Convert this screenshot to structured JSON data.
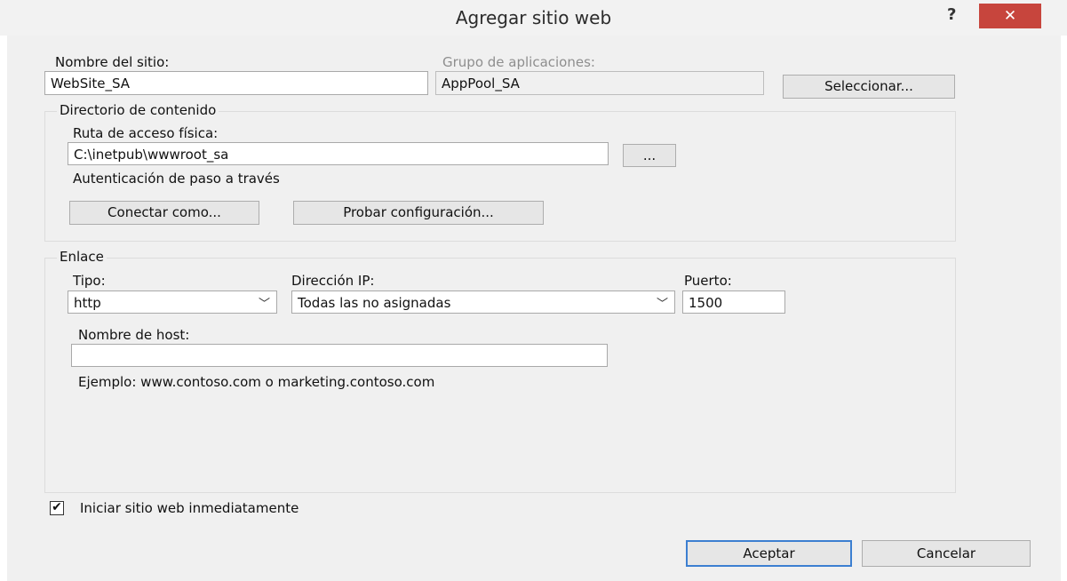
{
  "window": {
    "title": "Agregar sitio web",
    "help_glyph": "?",
    "close_glyph": "✕"
  },
  "site": {
    "name_label": "Nombre del sitio:",
    "name_value": "WebSite_SA",
    "app_pool_label": "Grupo de aplicaciones:",
    "app_pool_value": "AppPool_SA",
    "select_button": "Seleccionar..."
  },
  "content_directory": {
    "group_title": "Directorio de contenido",
    "physical_path_label": "Ruta de acceso física:",
    "physical_path_value": "C:\\inetpub\\wwwroot_sa",
    "browse_button": "...",
    "auth_text": "Autenticación de paso a través",
    "connect_as_button": "Conectar como...",
    "test_settings_button": "Probar configuración..."
  },
  "binding": {
    "group_title": "Enlace",
    "type_label": "Tipo:",
    "type_value": "http",
    "ip_label": "Dirección IP:",
    "ip_value": "Todas las no asignadas",
    "port_label": "Puerto:",
    "port_value": "1500",
    "host_label": "Nombre de host:",
    "host_value": "",
    "example_text": "Ejemplo: www.contoso.com o marketing.contoso.com"
  },
  "start_immediately": {
    "label": "Iniciar sitio web inmediatamente",
    "checked": true,
    "check_glyph": "✔"
  },
  "footer": {
    "ok_button": "Aceptar",
    "cancel_button": "Cancelar"
  },
  "icons": {
    "dropdown": "chevron-down-icon",
    "checkbox": "checkmark-icon",
    "close": "close-icon",
    "help": "help-icon"
  },
  "colors": {
    "close_button": "#c7453d",
    "default_button_border": "#3c7fd1",
    "dialog_background": "#f0f0f0"
  }
}
